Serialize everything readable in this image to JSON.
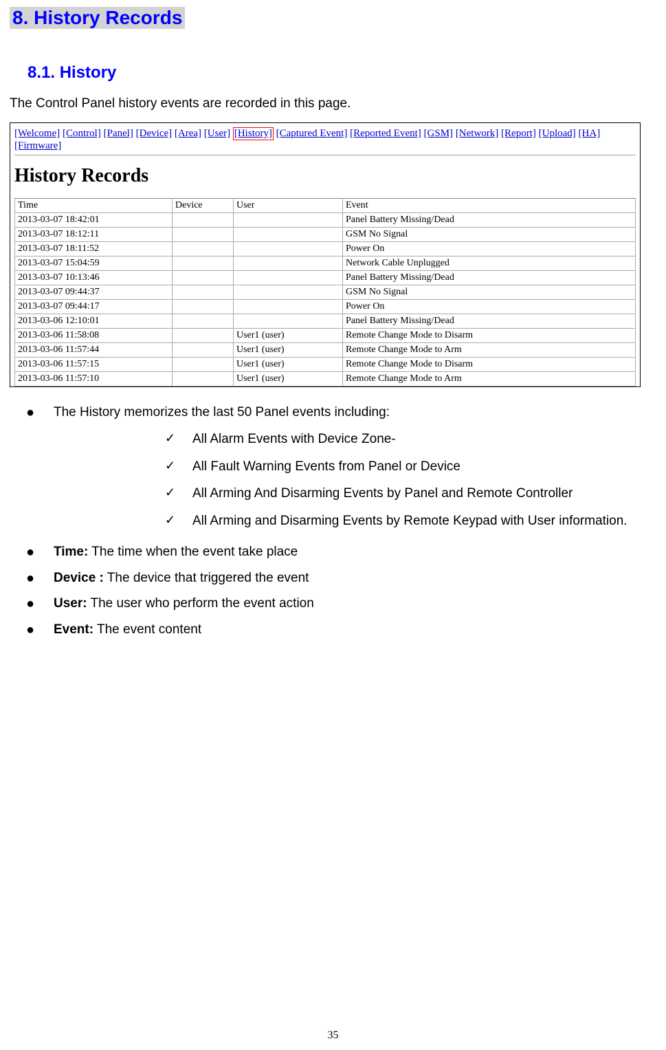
{
  "heading": "8. History Records",
  "subheading": "8.1. History",
  "intro": "The Control Panel history events are recorded in this page.",
  "nav": {
    "items": [
      "Welcome",
      "Control",
      "Panel",
      "Device",
      "Area",
      "User",
      "History",
      "Captured Event",
      "Reported Event",
      "GSM",
      "Network",
      "Report",
      "Upload",
      "HA",
      "Firmware"
    ],
    "active": "History"
  },
  "inner_title": "History Records",
  "table": {
    "headers": {
      "time": "Time",
      "device": "Device",
      "user": "User",
      "event": "Event"
    },
    "rows": [
      {
        "time": "2013-03-07 18:42:01",
        "device": "",
        "user": "",
        "event": "Panel Battery Missing/Dead"
      },
      {
        "time": "2013-03-07 18:12:11",
        "device": "",
        "user": "",
        "event": "GSM No Signal"
      },
      {
        "time": "2013-03-07 18:11:52",
        "device": "",
        "user": "",
        "event": "Power On"
      },
      {
        "time": "2013-03-07 15:04:59",
        "device": "",
        "user": "",
        "event": "Network Cable Unplugged"
      },
      {
        "time": "2013-03-07 10:13:46",
        "device": "",
        "user": "",
        "event": "Panel Battery Missing/Dead"
      },
      {
        "time": "2013-03-07 09:44:37",
        "device": "",
        "user": "",
        "event": "GSM No Signal"
      },
      {
        "time": "2013-03-07 09:44:17",
        "device": "",
        "user": "",
        "event": "Power On"
      },
      {
        "time": "2013-03-06 12:10:01",
        "device": "",
        "user": "",
        "event": "Panel Battery Missing/Dead"
      },
      {
        "time": "2013-03-06 11:58:08",
        "device": "",
        "user": "User1 (user)",
        "event": "Remote Change Mode to Disarm"
      },
      {
        "time": "2013-03-06 11:57:44",
        "device": "",
        "user": "User1 (user)",
        "event": "Remote Change Mode to Arm"
      },
      {
        "time": "2013-03-06 11:57:15",
        "device": "",
        "user": "User1 (user)",
        "event": "Remote Change Mode to Disarm"
      },
      {
        "time": "2013-03-06 11:57:10",
        "device": "",
        "user": "User1 (user)",
        "event": "Remote Change Mode to Arm"
      }
    ]
  },
  "main_bullets": {
    "intro_bullet": "The History memorizes the last 50 Panel events including:",
    "checks": [
      "All Alarm Events with Device Zone-",
      "All Fault Warning Events from Panel or Device",
      "All Arming And Disarming Events by Panel and Remote Controller",
      "All Arming and Disarming Events by Remote Keypad with User information."
    ],
    "defs": [
      {
        "label": "Time:",
        "text": " The time when the event take place"
      },
      {
        "label": "Device :",
        "text": " The device that triggered the event"
      },
      {
        "label": "User:",
        "text": " The user who perform the event action"
      },
      {
        "label": "Event:",
        "text": " The event content"
      }
    ]
  },
  "page_number": "35"
}
